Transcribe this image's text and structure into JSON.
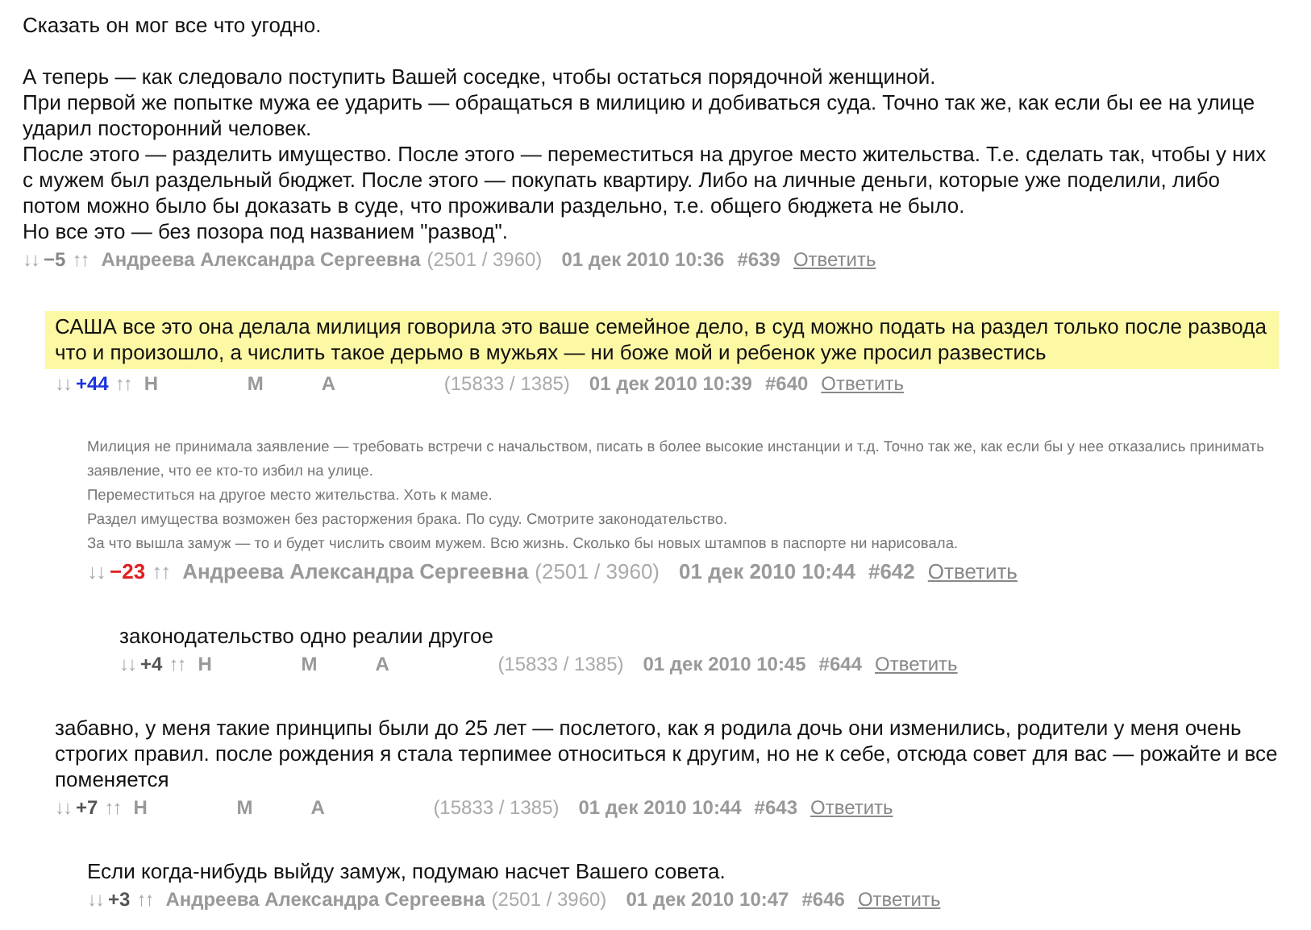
{
  "comments": [
    {
      "blocks": [
        [
          "Сказать он мог все что угодно."
        ],
        [
          "А теперь — как следовало поступить Вашей соседке, чтобы остаться порядочной женщиной.",
          "При первой же попытке мужа ее ударить — обращаться в милицию и добиваться суда. Точно так же, как если бы ее на улице ударил посторонний человек.",
          "После этого — разделить имущество. После этого — переместиться на другое место жительства. Т.е. сделать так, чтобы у них с мужем был раздельный бюджет. После этого — покупать квартиру. Либо на личные деньги, которые уже поделили, либо потом можно было бы доказать в суде, что проживали раздельно, т.е. общего бюджета не было.",
          "Но все это — без позора под названием \"развод\"."
        ]
      ],
      "faded": false,
      "highlighted": false,
      "meta": {
        "down": "↓↓",
        "rating": "−5",
        "color": "#888888",
        "up": "↑↑",
        "author": [
          "Андреева Александра Сергеевна"
        ],
        "stats": "(2501 / 3960)",
        "date": "01 дек 2010 10:36",
        "number": "#639",
        "reply": "Ответить"
      },
      "children": [
        {
          "blocks": [
            [
              "САША все это она делала милиция говорила это ваше семейное дело, в суд можно подать на раздел только после развода что и произошло, а числить такое дерьмо в мужьях — ни боже мой и ребенок уже просил развестись"
            ]
          ],
          "faded": false,
          "highlighted": true,
          "meta": {
            "down": "↓↓",
            "rating": "+44",
            "color": "#1a33dd",
            "up": "↑↑",
            "author": [
              "Н",
              "М",
              "А"
            ],
            "stats": "(15833 / 1385)",
            "date": "01 дек 2010 10:39",
            "number": "#640",
            "reply": "Ответить"
          },
          "children": [
            {
              "blocks": [
                [
                  "Милиция не принимала заявление — требовать встречи с начальством, писать в более высокие инстанции и т.д. Точно так же, как если бы у нее отказались принимать заявление, что ее кто-то избил на улице.",
                  "Переместиться на другое место жительства. Хоть к маме.",
                  "Раздел имущества возможен без расторжения брака. По суду. Смотрите законодательство.",
                  "За что вышла замуж — то и будет числить своим мужем. Всю жизнь. Сколько бы новых штампов в паспорте ни нарисовала."
                ]
              ],
              "faded": true,
              "highlighted": false,
              "meta": {
                "down": "↓↓",
                "rating": "−23",
                "color": "#e02020",
                "up": "↑↑",
                "author": [
                  "Андреева Александра Сергеевна"
                ],
                "stats": "(2501 / 3960)",
                "date": "01 дек 2010 10:44",
                "number": "#642",
                "reply": "Ответить"
              },
              "children": [
                {
                  "blocks": [
                    [
                      "законодательство одно реалии другое"
                    ]
                  ],
                  "faded": false,
                  "highlighted": false,
                  "meta": {
                    "down": "↓↓",
                    "rating": "+4",
                    "color": "#555555",
                    "up": "↑↑",
                    "author": [
                      "Н",
                      "М",
                      "А"
                    ],
                    "stats": "(15833 / 1385)",
                    "date": "01 дек 2010 10:45",
                    "number": "#644",
                    "reply": "Ответить"
                  }
                }
              ]
            }
          ]
        },
        {
          "blocks": [
            [
              "забавно, у меня такие принципы были до 25 лет — послетого, как я родила дочь они изменились, родители у меня очень строгих правил. после рождения я стала терпимее относиться к другим, но не к себе, отсюда совет для вас — рожайте и все поменяется"
            ]
          ],
          "faded": false,
          "highlighted": false,
          "meta": {
            "down": "↓↓",
            "rating": "+7",
            "color": "#555555",
            "up": "↑↑",
            "author": [
              "Н",
              "М",
              "А"
            ],
            "stats": "(15833 / 1385)",
            "date": "01 дек 2010 10:44",
            "number": "#643",
            "reply": "Ответить"
          },
          "children": [
            {
              "blocks": [
                [
                  "Если когда-нибудь выйду замуж, подумаю насчет Вашего совета."
                ]
              ],
              "faded": false,
              "highlighted": false,
              "meta": {
                "down": "↓↓",
                "rating": "+3",
                "color": "#555555",
                "up": "↑↑",
                "author": [
                  "Андреева Александра Сергеевна"
                ],
                "stats": "(2501 / 3960)",
                "date": "01 дек 2010 10:47",
                "number": "#646",
                "reply": "Ответить"
              }
            }
          ]
        }
      ]
    }
  ]
}
